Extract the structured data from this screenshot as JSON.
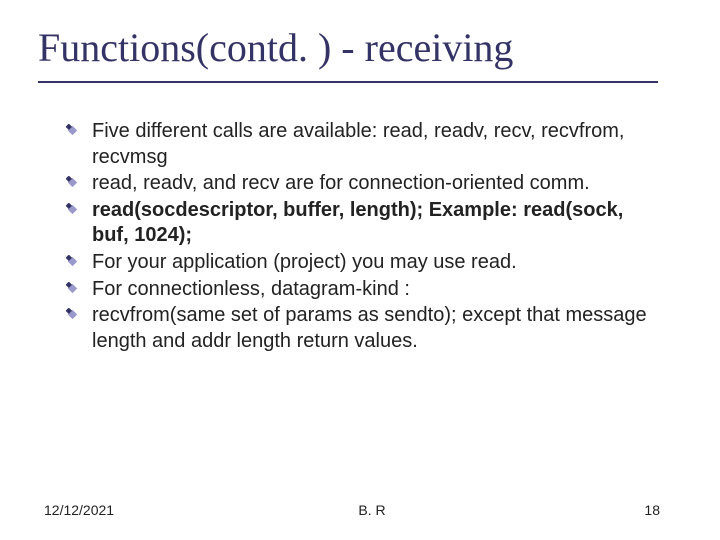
{
  "title": "Functions(contd. ) - receiving",
  "bullets": [
    {
      "text": "Five different calls are available: read, readv, recv, recvfrom, recvmsg",
      "bold": false
    },
    {
      "text": "read, readv, and recv are for connection-oriented comm.",
      "bold": false
    },
    {
      "text": "read(socdescriptor, buffer, length); Example: read(sock, buf, 1024);",
      "bold": true
    },
    {
      "text": "For your application (project) you may use read.",
      "bold": false
    },
    {
      "text": "For connectionless, datagram-kind :",
      "bold": false
    },
    {
      "text": "recvfrom(same set of params as sendto); except that message length and addr length return values.",
      "bold": false
    }
  ],
  "footer": {
    "date": "12/12/2021",
    "center": "B. R",
    "pagenum": "18"
  },
  "colors": {
    "accent": "#333366"
  }
}
